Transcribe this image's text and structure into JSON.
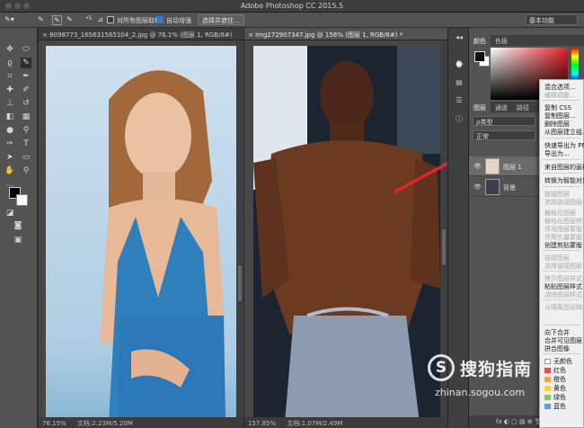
{
  "app": {
    "title": "Adobe Photoshop CC 2015.5"
  },
  "options_bar": {
    "sample_all_layers": "对所有图层取样",
    "auto_enhance": "自动增强",
    "select_and_mask": "选择并遮住...",
    "workspace": "基本功能",
    "brush_size": "5"
  },
  "documents": [
    {
      "tab": "8098773_165631565104_2.jpg @ 76.1% (图层 1, RGB/8#)",
      "zoom": "76.15%",
      "doc_info": "文档:2.23M/5.20M"
    },
    {
      "tab": "img272907347.jpg @ 158% (图层 1, RGB/8#) *",
      "zoom": "157.85%",
      "doc_info": "文档:1.07M/2.49M"
    }
  ],
  "color_panel": {
    "tabs": [
      "颜色",
      "色板"
    ]
  },
  "layers_panel": {
    "tabs": [
      "图层",
      "通道",
      "路径"
    ],
    "filter_label": "ρ类型",
    "blend_mode": "正常",
    "layers": [
      {
        "name": "图层 1",
        "selected": true
      },
      {
        "name": "背景",
        "selected": false
      }
    ],
    "footer_icons": "fx ◐ ▢ ▤ ⊕ 🗑"
  },
  "context_menu": {
    "items": [
      {
        "label": "混合选项...",
        "disabled": false
      },
      {
        "label": "编辑调整...",
        "disabled": true
      },
      {
        "label": "复制 CSS",
        "disabled": false
      },
      {
        "label": "复制图层...",
        "disabled": false
      },
      {
        "label": "删除图层",
        "disabled": false
      },
      {
        "label": "从图层建立组...",
        "disabled": false
      },
      {
        "label": "快速导出为 PNG",
        "disabled": false
      },
      {
        "label": "导出为...",
        "disabled": false
      },
      {
        "label": "来自图层的画板...",
        "disabled": false
      },
      {
        "label": "转换为智能对象",
        "disabled": false
      },
      {
        "label": "链接图层",
        "disabled": true
      },
      {
        "label": "选择链接图层",
        "disabled": true
      },
      {
        "label": "栅格化图层",
        "disabled": true
      },
      {
        "label": "栅格化图层样式",
        "disabled": true
      },
      {
        "label": "停用图层蒙版",
        "disabled": true
      },
      {
        "label": "停用矢量蒙版",
        "disabled": true
      },
      {
        "label": "创建剪贴蒙版",
        "disabled": false
      },
      {
        "label": "链接图层",
        "disabled": true
      },
      {
        "label": "选择链接图层",
        "disabled": true
      },
      {
        "label": "拷贝图层样式",
        "disabled": true
      },
      {
        "label": "粘贴图层样式",
        "disabled": false
      },
      {
        "label": "清除图层样式",
        "disabled": true
      },
      {
        "label": "从隔离图层释放",
        "disabled": true
      },
      {
        "label": "向下合并",
        "disabled": false
      },
      {
        "label": "合并可见图层",
        "disabled": false
      },
      {
        "label": "拼合图像",
        "disabled": false
      }
    ],
    "color_labels": [
      {
        "label": "无颜色",
        "color": "#ffffff"
      },
      {
        "label": "红色",
        "color": "#e2514f"
      },
      {
        "label": "橙色",
        "color": "#f1a14a"
      },
      {
        "label": "黄色",
        "color": "#f0d43a"
      },
      {
        "label": "绿色",
        "color": "#7cc36b"
      },
      {
        "label": "蓝色",
        "color": "#5c9ee0"
      }
    ]
  },
  "watermark": {
    "brand": "搜狗指南",
    "url": "zhinan.sogou.com",
    "logo_letter": "S"
  }
}
